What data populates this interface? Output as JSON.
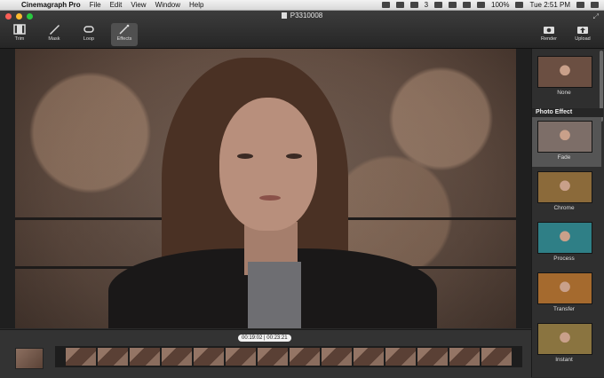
{
  "menubar": {
    "app_name": "Cinemagraph Pro",
    "menus": [
      "File",
      "Edit",
      "View",
      "Window",
      "Help"
    ],
    "status": {
      "notification_count": "3",
      "battery": "100%",
      "clock": "Tue 2:51 PM"
    }
  },
  "window": {
    "title": "P3310008"
  },
  "toolbar": {
    "tools": [
      {
        "label": "Trim",
        "icon": "film-icon"
      },
      {
        "label": "Mask",
        "icon": "brush-icon"
      },
      {
        "label": "Loop",
        "icon": "loop-icon"
      },
      {
        "label": "Effects",
        "icon": "wand-icon",
        "active": true
      }
    ],
    "render_label": "Render",
    "upload_label": "Upload"
  },
  "timeline": {
    "time": "00:19:02 | 00:23:21",
    "frame_count": 14
  },
  "sidebar": {
    "section_title": "Photo Effect",
    "effects": [
      {
        "label": "None",
        "tint": "#6b4f42"
      },
      {
        "label": "Fade",
        "tint": "#7d6e68",
        "selected": true
      },
      {
        "label": "Chrome",
        "tint": "#8b6a3a"
      },
      {
        "label": "Process",
        "tint": "#2f7f86"
      },
      {
        "label": "Transfer",
        "tint": "#a56a2e"
      },
      {
        "label": "Instant",
        "tint": "#8a7440"
      }
    ]
  }
}
